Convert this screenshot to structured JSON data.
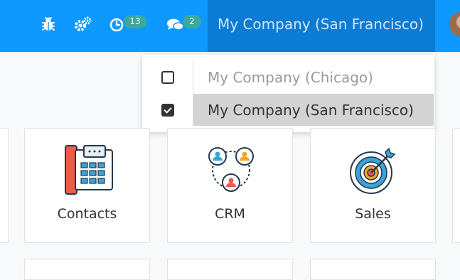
{
  "navbar": {
    "debug_icon": "bug-icon",
    "settings_icon": "gears-icon",
    "activity": {
      "icon": "clock-icon",
      "count": "13"
    },
    "messages": {
      "icon": "chat-icon",
      "count": "2"
    },
    "company_switcher": {
      "label": "My Company (San Francisco)"
    },
    "avatar": "user-avatar"
  },
  "company_dropdown": {
    "items": [
      {
        "label": "My Company (Chicago)",
        "checked": false
      },
      {
        "label": "My Company (San Francisco)",
        "checked": true
      }
    ]
  },
  "apps": [
    {
      "label": "Contacts",
      "icon": "contacts-icon"
    },
    {
      "label": "CRM",
      "icon": "crm-icon"
    },
    {
      "label": "Sales",
      "icon": "sales-target-icon"
    }
  ],
  "colors": {
    "navbar": "#0d99ff",
    "company_switcher_bg": "#0b7bd3",
    "badge": "#3ba99c",
    "dropdown_highlight": "#d3d3d3"
  }
}
